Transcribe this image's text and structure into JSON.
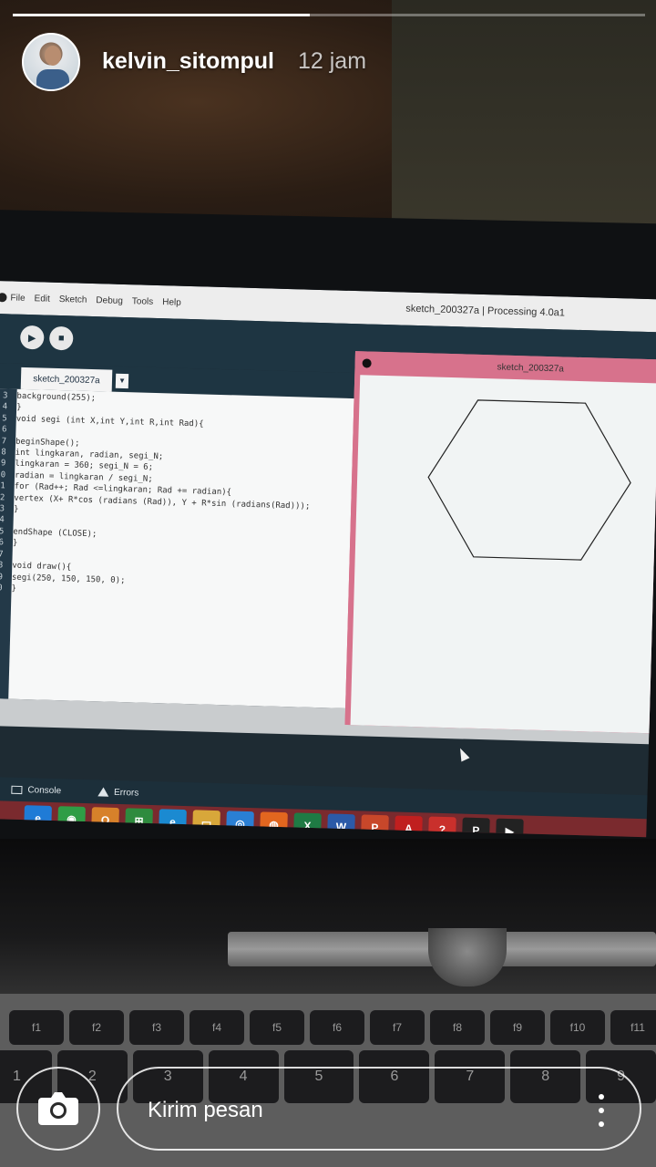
{
  "story": {
    "progress": 0.47,
    "username": "kelvin_sitompul",
    "time_ago": "12 jam",
    "message_placeholder": "Kirim pesan"
  },
  "processing": {
    "menu": [
      "File",
      "Edit",
      "Sketch",
      "Debug",
      "Tools",
      "Help"
    ],
    "window_title": "sketch_200327a | Processing 4.0a1",
    "tab_name": "sketch_200327a",
    "code_lines": [
      {
        "n": "3",
        "t": "background(255);"
      },
      {
        "n": "4",
        "t": "}"
      },
      {
        "n": "5",
        "t": "void segi (int X,int Y,int R,int Rad){"
      },
      {
        "n": "6",
        "t": ""
      },
      {
        "n": "7",
        "t": "beginShape();"
      },
      {
        "n": "8",
        "t": "int lingkaran, radian, segi_N;"
      },
      {
        "n": "9",
        "t": "lingkaran = 360; segi_N = 6;"
      },
      {
        "n": "10",
        "t": "radian = lingkaran / segi_N;"
      },
      {
        "n": "11",
        "t": "for (Rad++; Rad <=lingkaran; Rad += radian){"
      },
      {
        "n": "12",
        "t": "vertex (X+ R*cos (radians (Rad)), Y + R*sin (radians(Rad)));"
      },
      {
        "n": "13",
        "t": "}"
      },
      {
        "n": "14",
        "t": ""
      },
      {
        "n": "15",
        "t": "endShape (CLOSE);"
      },
      {
        "n": "16",
        "t": "}"
      },
      {
        "n": "17",
        "t": ""
      },
      {
        "n": "18",
        "t": "void draw(){"
      },
      {
        "n": "19",
        "t": "segi(250, 150, 150, 0);"
      },
      {
        "n": "20",
        "t": "}"
      }
    ],
    "sketch_title": "sketch_200327a",
    "console_label": "Console",
    "errors_label": "Errors",
    "sketch_border_color": "#d7728c"
  },
  "taskbar_apps": [
    {
      "name": "ie-icon",
      "glyph": "e",
      "color": "#1f7bd6"
    },
    {
      "name": "chrome-icon",
      "glyph": "◉",
      "color": "#2f9d46"
    },
    {
      "name": "outlook-icon",
      "glyph": "O",
      "color": "#d7812a"
    },
    {
      "name": "store-icon",
      "glyph": "⊞",
      "color": "#2e8b3e"
    },
    {
      "name": "edge-icon",
      "glyph": "e",
      "color": "#1b8ad1"
    },
    {
      "name": "explorer-icon",
      "glyph": "▭",
      "color": "#d8a73a"
    },
    {
      "name": "browser-icon",
      "glyph": "◎",
      "color": "#2a7fd4"
    },
    {
      "name": "firefox-icon",
      "glyph": "◍",
      "color": "#e2661f"
    },
    {
      "name": "excel-icon",
      "glyph": "X",
      "color": "#1f7a44"
    },
    {
      "name": "word-icon",
      "glyph": "W",
      "color": "#2b5aa8"
    },
    {
      "name": "powerpoint-icon",
      "glyph": "P",
      "color": "#c8472a"
    },
    {
      "name": "acrobat-icon",
      "glyph": "A",
      "color": "#c01f1f"
    },
    {
      "name": "help-icon",
      "glyph": "?",
      "color": "#c9302c"
    },
    {
      "name": "processing-icon",
      "glyph": "P",
      "color": "#222222"
    },
    {
      "name": "media-icon",
      "glyph": "▶",
      "color": "#222222"
    }
  ]
}
